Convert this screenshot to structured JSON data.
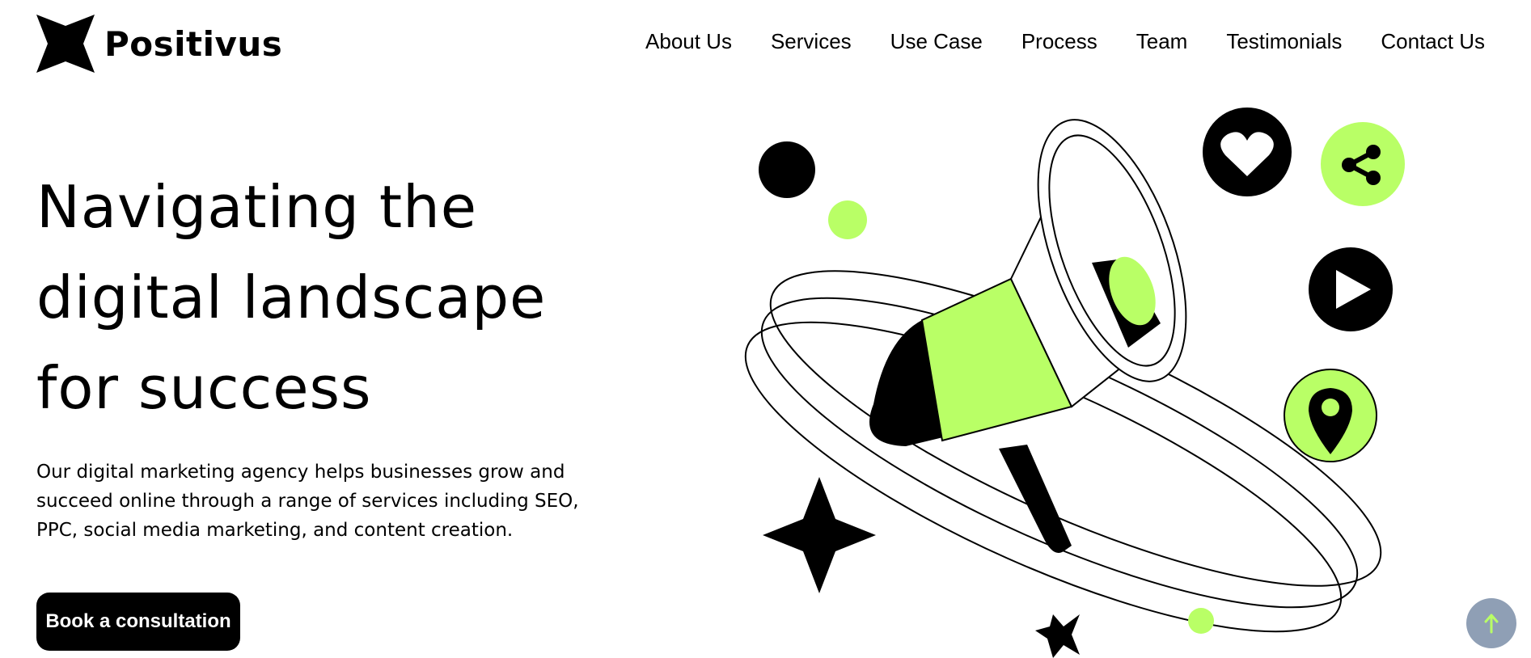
{
  "brand": {
    "name": "Positivus",
    "accent": "#B9FF66",
    "dark": "#000000"
  },
  "nav": {
    "items": [
      {
        "label": "About Us"
      },
      {
        "label": "Services"
      },
      {
        "label": "Use Case"
      },
      {
        "label": "Process"
      },
      {
        "label": "Team"
      },
      {
        "label": "Testimonials"
      },
      {
        "label": "Contact Us"
      }
    ]
  },
  "hero": {
    "title_lines": [
      "Navigating the",
      "digital landscape",
      "for success"
    ],
    "description": "Our digital marketing agency helps businesses grow and succeed online through a range of services including SEO, PPC, social media marketing, and content creation.",
    "cta_label": "Book a consultation"
  },
  "illustration": {
    "icons": [
      "megaphone-icon",
      "heart-icon",
      "share-icon",
      "play-icon",
      "location-pin-icon",
      "sparkle-star-icon"
    ]
  },
  "scroll_top": {
    "icon": "arrow-up-icon",
    "color": "#8F9FB5",
    "arrow_color": "#B9FF66"
  }
}
